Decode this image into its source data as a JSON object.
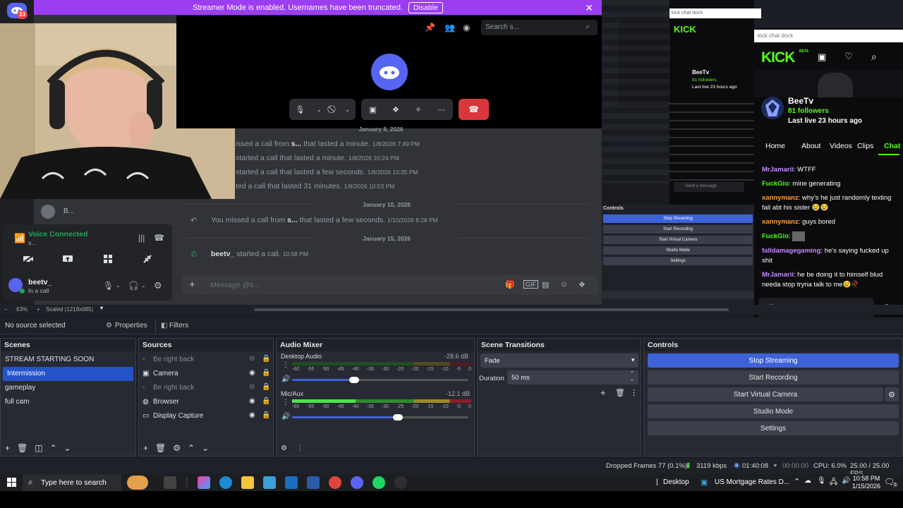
{
  "discord": {
    "badge_count": "33",
    "banner_text": "Streamer Mode is enabled. Usernames have been truncated.",
    "banner_button": "Disable",
    "search_placeholder": "Search s...",
    "user_short": "B...",
    "voice_status": "Voice Connected",
    "voice_sub": "s...",
    "username": "beetv_",
    "user_status": "In a call",
    "date_top": "January 8, 2026",
    "messages": [
      {
        "prefix": "issed a call from ",
        "user": "s...",
        "text": " that lasted a minute.",
        "time": "1/8/2026 7:49 PM"
      },
      {
        "prefix": "started a call that lasted a minute.",
        "user": "",
        "text": "",
        "time": "1/8/2026 10:24 PM"
      },
      {
        "prefix": "started a call that lasted a few seconds.",
        "user": "",
        "text": "",
        "time": "1/8/2026 10:35 PM"
      },
      {
        "prefix": "ted a call that lasted 31 minutes.",
        "user": "",
        "text": "",
        "time": "1/8/2026 10:53 PM"
      }
    ],
    "date_1": "January 10, 2026",
    "missed_prefix": "You missed a call from ",
    "missed_user": "s...",
    "missed_text": " that lasted a few seconds.",
    "missed_time": "1/10/2026 8:28 PM",
    "date_2": "January 15, 2026",
    "call_user": "beetv_",
    "call_text": " started a call.",
    "call_time": "10:58 PM",
    "message_placeholder": "Message @s..."
  },
  "kick": {
    "dock_title": "kick chat dock",
    "logo": "KICK",
    "logo_sup": "BETA",
    "channel_name": "BeeTv",
    "followers": "81 followers",
    "last_live": "Last live 23 hours ago",
    "tabs": [
      "Home",
      "About",
      "Videos",
      "Clips",
      "Chat"
    ],
    "chat": [
      {
        "user": "MrJamarii",
        "color": "#c58aff",
        "text": ": WTFF"
      },
      {
        "user": "FuckGio",
        "color": "#53fc18",
        "text": ": mine generating"
      },
      {
        "user": "xannymanz",
        "color": "#ff9f3a",
        "text": ": why's he just randomly texting fall abt his sister 😢😢"
      },
      {
        "user": "xannymanz",
        "color": "#ff9f3a",
        "text": ": guys bored"
      },
      {
        "user": "FuckGio",
        "color": "#53fc18",
        "text": ":"
      },
      {
        "user": "falldamagegaming",
        "color": "#c58aff",
        "text": ": he's saying fucked up shit"
      },
      {
        "user": "MrJamarii",
        "color": "#c58aff",
        "text": ": he be doing it to himself blud needa stop tryna talk to me😢🥀"
      }
    ],
    "send_placeholder": "Send a message",
    "small_controls": [
      "Stop Streaming",
      "Start Recording",
      "Start Virtual Camera",
      "Studio Mode",
      "Settings"
    ]
  },
  "obs": {
    "zoom": "63%",
    "scaled": "Scaled (1218x685)",
    "no_source": "No source selected",
    "properties": "Properties",
    "filters": "Filters",
    "scenes_title": "Scenes",
    "scenes": [
      "STREAM STARTING SOON",
      "Intermission",
      "gameplay",
      "full cam"
    ],
    "sources_title": "Sources",
    "sources": [
      "Be right back",
      "Camera",
      "Be right back",
      "Browser",
      "Display Capture"
    ],
    "mixer_title": "Audio Mixer",
    "tracks": [
      {
        "name": "Desktop Audio",
        "db": "-28.6 dB",
        "level": 0.35
      },
      {
        "name": "Mic/Aux",
        "db": "-12.1 dB",
        "level": 0.6
      }
    ],
    "ticks": [
      "-60",
      "-55",
      "-50",
      "-45",
      "-40",
      "-35",
      "-30",
      "-25",
      "-20",
      "-15",
      "-10",
      "-5",
      "0"
    ],
    "transitions_title": "Scene Transitions",
    "transition": "Fade",
    "duration_label": "Duration",
    "duration": "50 ms",
    "controls_title": "Controls",
    "controls": [
      "Stop Streaming",
      "Start Recording",
      "Start Virtual Camera",
      "Studio Mode",
      "Settings"
    ],
    "status": {
      "dropped": "Dropped Frames 77 (0.1%)",
      "kbps": "3119 kbps",
      "live_time": "01:40:08",
      "rec_time": "00:00:00",
      "cpu": "CPU: 6.0%",
      "fps": "25.00 / 25.00 FPS"
    }
  },
  "taskbar": {
    "search": "Type here to search",
    "desktop": "Desktop",
    "window": "US Mortgage Rates D...",
    "time": "10:58 PM",
    "date": "1/15/2026",
    "notif": "5"
  }
}
